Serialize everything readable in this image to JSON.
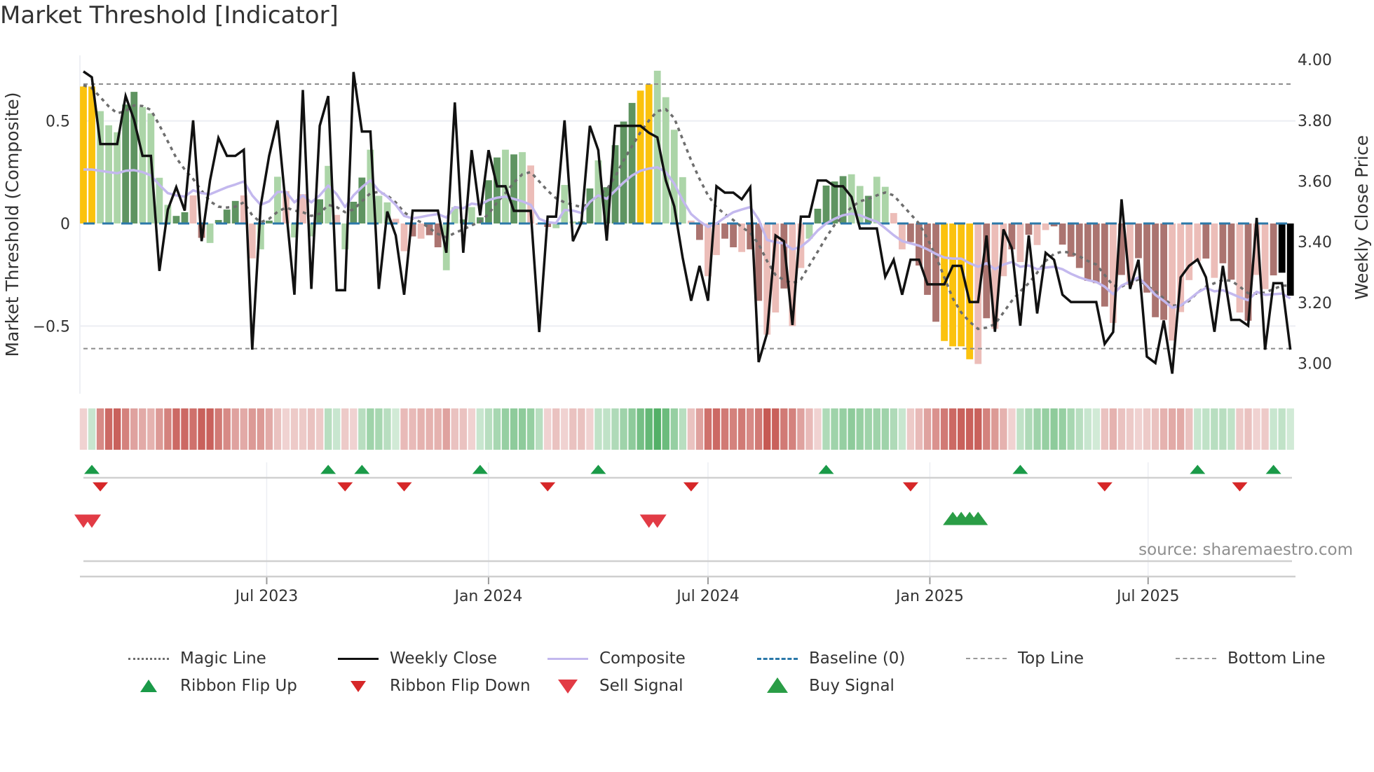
{
  "title": "Market Threshold [Indicator]",
  "source": "source: sharemaestro.com",
  "legend": [
    {
      "key": "magic",
      "label": "Magic Line"
    },
    {
      "key": "close",
      "label": "Weekly Close"
    },
    {
      "key": "composite",
      "label": "Composite"
    },
    {
      "key": "baseline",
      "label": "Baseline (0)"
    },
    {
      "key": "top",
      "label": "Top Line"
    },
    {
      "key": "bottom",
      "label": "Bottom Line"
    },
    {
      "key": "flip_up",
      "label": "Ribbon Flip Up"
    },
    {
      "key": "flip_down",
      "label": "Ribbon Flip Down"
    },
    {
      "key": "sell",
      "label": "Sell Signal"
    },
    {
      "key": "buy",
      "label": "Buy Signal"
    }
  ],
  "colors": {
    "extreme": "#fbc20d",
    "bull_strong": "#5f9461",
    "bull_weak": "#acd5a8",
    "bear_strong": "#ab7470",
    "bear_weak": "#ecbdb8",
    "magic": "#6e6e6e",
    "close": "#111111",
    "composite": "#c3b8ee",
    "baseline": "#2b78a9",
    "threshold": "#8c8c8c",
    "ribbon_green": "#4fae63",
    "ribbon_red": "#c5554f",
    "flip_up": "#1a9a48",
    "flip_down": "#d62728",
    "sell": "#e23b45",
    "buy": "#2a9d46"
  },
  "chart_data": {
    "type": "bar",
    "title": "Market Threshold [Indicator]",
    "ylabel": "Market Threshold (Composite)",
    "y2label": "Weekly Close Price",
    "ylim": [
      -0.83,
      0.82
    ],
    "y2lim": [
      2.9,
      4.014
    ],
    "yticks": [
      {
        "v": 0.5,
        "label": "0.5"
      },
      {
        "v": 0,
        "label": "0"
      },
      {
        "v": -0.5,
        "label": "−0.5"
      }
    ],
    "y2ticks": [
      {
        "v": 4.0,
        "label": "4.00"
      },
      {
        "v": 3.8,
        "label": "3.80"
      },
      {
        "v": 3.6,
        "label": "3.60"
      },
      {
        "v": 3.4,
        "label": "3.40"
      },
      {
        "v": 3.2,
        "label": "3.20"
      },
      {
        "v": 3.0,
        "label": "3.00"
      }
    ],
    "x_start": "2023-01-30",
    "x_step_days": 7,
    "xticks": [
      {
        "date": "2023-07-01",
        "label": "Jul 2023"
      },
      {
        "date": "2024-01-01",
        "label": "Jan 2024"
      },
      {
        "date": "2024-07-01",
        "label": "Jul 2024"
      },
      {
        "date": "2025-01-01",
        "label": "Jan 2025"
      },
      {
        "date": "2025-07-01",
        "label": "Jul 2025"
      }
    ],
    "top_line": 0.68,
    "bottom_line": -0.61,
    "baseline": 0,
    "bar_type_legend": {
      "Y": "extreme",
      "G": "bull_strong",
      "g": "bull_weak",
      "R": "bear_strong",
      "r": "bear_weak"
    },
    "composite_bars": [
      0.668,
      0.668,
      0.548,
      0.479,
      0.445,
      0.58,
      0.642,
      0.568,
      0.537,
      0.223,
      0.091,
      0.037,
      0.055,
      0.137,
      -0.07,
      -0.095,
      0.017,
      0.068,
      0.11,
      0.137,
      -0.17,
      -0.126,
      0.014,
      0.228,
      0.158,
      -0.068,
      0.143,
      -0.063,
      0.118,
      0.281,
      0.042,
      -0.126,
      0.106,
      0.224,
      0.36,
      0.135,
      0.103,
      0.023,
      -0.135,
      -0.063,
      -0.074,
      -0.057,
      -0.116,
      -0.228,
      0.08,
      0.02,
      0.08,
      0.03,
      0.211,
      0.322,
      0.36,
      0.337,
      0.348,
      0.283,
      -0.005,
      -0.017,
      -0.023,
      0.188,
      0.01,
      0.01,
      0.171,
      0.308,
      0.177,
      0.382,
      0.497,
      0.588,
      0.648,
      0.679,
      0.745,
      0.616,
      0.457,
      0.226,
      0.014,
      -0.08,
      -0.257,
      -0.154,
      -0.074,
      -0.116,
      -0.139,
      -0.126,
      -0.377,
      -0.542,
      -0.434,
      -0.317,
      -0.5,
      -0.217,
      -0.074,
      0.072,
      0.185,
      0.205,
      0.231,
      0.24,
      0.183,
      0.135,
      0.228,
      0.179,
      0.051,
      -0.126,
      -0.091,
      -0.205,
      -0.348,
      -0.479,
      -0.573,
      -0.599,
      -0.599,
      -0.662,
      -0.685,
      -0.462,
      -0.514,
      -0.257,
      -0.126,
      -0.188,
      -0.055,
      -0.105,
      -0.032,
      -0.014,
      -0.103,
      -0.162,
      -0.217,
      -0.28,
      -0.291,
      -0.405,
      -0.485,
      -0.251,
      -0.3,
      -0.169,
      -0.337,
      -0.457,
      -0.47,
      -0.571,
      -0.432,
      -0.276,
      -0.183,
      -0.171,
      -0.265,
      -0.194,
      -0.274,
      -0.434,
      -0.474,
      -0.251,
      -0.32,
      -0.253,
      -0.24,
      -0.352
    ],
    "bar_types": "YYgggGGggggGGrRgGGGrrgGgrgrgGgrgGGgggrrRrRRggGgGGGgGgrRRgggGGgGGGGYYggggrRrrRRrRRrrRrrgGGGGggGggrrRRRRYYYYrRrrRrRrrRRRRRRRrRrRRRRrrrrRrRRrRrrR",
    "weekly_close": [
      3.961,
      3.942,
      3.722,
      3.722,
      3.722,
      3.88,
      3.802,
      3.683,
      3.683,
      3.304,
      3.506,
      3.58,
      3.503,
      3.8,
      3.402,
      3.602,
      3.742,
      3.683,
      3.683,
      3.703,
      3.045,
      3.517,
      3.683,
      3.8,
      3.51,
      3.226,
      3.9,
      3.245,
      3.782,
      3.88,
      3.241,
      3.241,
      3.959,
      3.763,
      3.763,
      3.245,
      3.5,
      3.421,
      3.226,
      3.503,
      3.503,
      3.503,
      3.503,
      3.364,
      3.859,
      3.364,
      3.702,
      3.487,
      3.702,
      3.583,
      3.583,
      3.502,
      3.502,
      3.502,
      3.103,
      3.483,
      3.483,
      3.8,
      3.402,
      3.464,
      3.782,
      3.702,
      3.404,
      3.782,
      3.782,
      3.782,
      3.782,
      3.759,
      3.744,
      3.602,
      3.517,
      3.348,
      3.206,
      3.321,
      3.206,
      3.583,
      3.562,
      3.562,
      3.54,
      3.58,
      3.004,
      3.099,
      3.421,
      3.402,
      3.126,
      3.483,
      3.483,
      3.602,
      3.602,
      3.583,
      3.583,
      3.548,
      3.444,
      3.444,
      3.444,
      3.285,
      3.341,
      3.226,
      3.341,
      3.341,
      3.26,
      3.26,
      3.26,
      3.321,
      3.321,
      3.202,
      3.202,
      3.421,
      3.104,
      3.441,
      3.379,
      3.124,
      3.421,
      3.164,
      3.364,
      3.341,
      3.226,
      3.202,
      3.202,
      3.202,
      3.202,
      3.064,
      3.103,
      3.54,
      3.245,
      3.341,
      3.022,
      3.001,
      3.141,
      2.966,
      3.283,
      3.321,
      3.342,
      3.283,
      3.104,
      3.321,
      3.143,
      3.143,
      3.124,
      3.479,
      3.045,
      3.264,
      3.264,
      3.045
    ],
    "magic_line": [
      0.674,
      0.66,
      0.616,
      0.571,
      0.537,
      0.548,
      0.576,
      0.573,
      0.554,
      0.479,
      0.4,
      0.32,
      0.263,
      0.217,
      0.16,
      0.108,
      0.082,
      0.078,
      0.082,
      0.103,
      0.04,
      0.006,
      0.023,
      0.057,
      0.078,
      0.063,
      0.055,
      0.037,
      0.048,
      0.091,
      0.08,
      0.055,
      0.068,
      0.108,
      0.148,
      0.154,
      0.137,
      0.103,
      0.055,
      0.025,
      0.006,
      -0.023,
      -0.051,
      -0.068,
      -0.046,
      -0.029,
      -0.009,
      0.009,
      0.046,
      0.103,
      0.148,
      0.2,
      0.24,
      0.251,
      0.205,
      0.16,
      0.123,
      0.103,
      0.091,
      0.08,
      0.1,
      0.137,
      0.166,
      0.228,
      0.308,
      0.377,
      0.445,
      0.502,
      0.548,
      0.557,
      0.514,
      0.411,
      0.308,
      0.217,
      0.137,
      0.08,
      0.046,
      0.017,
      -0.017,
      -0.046,
      -0.1,
      -0.183,
      -0.251,
      -0.276,
      -0.291,
      -0.274,
      -0.205,
      -0.137,
      -0.068,
      -0.006,
      0.034,
      0.08,
      0.108,
      0.12,
      0.137,
      0.151,
      0.137,
      0.091,
      0.046,
      0,
      -0.074,
      -0.16,
      -0.263,
      -0.365,
      -0.434,
      -0.479,
      -0.514,
      -0.508,
      -0.491,
      -0.434,
      -0.377,
      -0.331,
      -0.291,
      -0.24,
      -0.183,
      -0.148,
      -0.137,
      -0.143,
      -0.16,
      -0.183,
      -0.2,
      -0.251,
      -0.303,
      -0.308,
      -0.285,
      -0.274,
      -0.303,
      -0.331,
      -0.365,
      -0.4,
      -0.4,
      -0.377,
      -0.337,
      -0.308,
      -0.291,
      -0.276,
      -0.279,
      -0.308,
      -0.34,
      -0.342,
      -0.337,
      -0.32,
      -0.303,
      -0.303
    ],
    "composite_line": [
      0.263,
      0.263,
      0.257,
      0.251,
      0.245,
      0.257,
      0.26,
      0.251,
      0.234,
      0.188,
      0.148,
      0.137,
      0.131,
      0.162,
      0.148,
      0.143,
      0.16,
      0.177,
      0.19,
      0.205,
      0.137,
      0.091,
      0.108,
      0.154,
      0.154,
      0.103,
      0.137,
      0.103,
      0.137,
      0.185,
      0.143,
      0.08,
      0.137,
      0.177,
      0.211,
      0.16,
      0.131,
      0.091,
      0.037,
      0.025,
      0.032,
      0.04,
      0.046,
      0.029,
      0.08,
      0.074,
      0.097,
      0.091,
      0.114,
      0.126,
      0.131,
      0.12,
      0.108,
      0.091,
      0.023,
      0.006,
      0.002,
      0.066,
      0.063,
      0.051,
      0.105,
      0.137,
      0.12,
      0.16,
      0.2,
      0.234,
      0.257,
      0.268,
      0.274,
      0.251,
      0.194,
      0.114,
      0.046,
      0.011,
      -0.017,
      0,
      0.029,
      0.055,
      0.068,
      0.08,
      0.02,
      -0.08,
      -0.091,
      -0.097,
      -0.126,
      -0.114,
      -0.08,
      -0.034,
      0,
      0.023,
      0.04,
      0.048,
      0.04,
      0.023,
      0.009,
      -0.023,
      -0.057,
      -0.086,
      -0.097,
      -0.108,
      -0.126,
      -0.148,
      -0.166,
      -0.171,
      -0.171,
      -0.194,
      -0.211,
      -0.194,
      -0.223,
      -0.2,
      -0.188,
      -0.211,
      -0.205,
      -0.223,
      -0.215,
      -0.211,
      -0.223,
      -0.245,
      -0.263,
      -0.276,
      -0.285,
      -0.308,
      -0.345,
      -0.303,
      -0.283,
      -0.263,
      -0.303,
      -0.348,
      -0.377,
      -0.411,
      -0.4,
      -0.371,
      -0.337,
      -0.314,
      -0.331,
      -0.325,
      -0.342,
      -0.36,
      -0.374,
      -0.333,
      -0.348,
      -0.345,
      -0.342,
      -0.365
    ],
    "ribbon": [
      -0.15,
      0.2,
      -0.6,
      -0.8,
      -0.85,
      -0.65,
      -0.45,
      -0.4,
      -0.35,
      -0.5,
      -0.65,
      -0.8,
      -0.8,
      -0.75,
      -0.85,
      -0.85,
      -0.7,
      -0.6,
      -0.45,
      -0.4,
      -0.5,
      -0.5,
      -0.4,
      -0.25,
      -0.15,
      -0.2,
      -0.2,
      -0.25,
      -0.2,
      0.3,
      0.2,
      -0.2,
      -0.15,
      0.3,
      0.45,
      0.4,
      0.3,
      0.15,
      -0.3,
      -0.3,
      -0.35,
      -0.35,
      -0.35,
      -0.45,
      -0.25,
      -0.25,
      -0.15,
      0.2,
      0.3,
      0.4,
      0.5,
      0.55,
      0.55,
      0.5,
      0.3,
      -0.15,
      -0.25,
      -0.15,
      -0.25,
      -0.25,
      -0.15,
      0.25,
      0.25,
      0.35,
      0.45,
      0.55,
      0.7,
      0.8,
      0.9,
      0.75,
      0.5,
      0.3,
      -0.25,
      -0.45,
      -0.75,
      -0.8,
      -0.7,
      -0.65,
      -0.7,
      -0.6,
      -0.7,
      -0.9,
      -0.85,
      -0.7,
      -0.65,
      -0.45,
      -0.3,
      -0.15,
      0.35,
      0.45,
      0.5,
      0.55,
      0.5,
      0.45,
      0.45,
      0.45,
      0.35,
      0.2,
      -0.2,
      -0.3,
      -0.45,
      -0.55,
      -0.7,
      -0.8,
      -0.85,
      -0.85,
      -0.85,
      -0.65,
      -0.5,
      -0.35,
      -0.15,
      0.25,
      0.35,
      0.45,
      0.5,
      0.55,
      0.5,
      0.4,
      0.3,
      0.2,
      0.15,
      -0.25,
      -0.35,
      -0.25,
      -0.2,
      -0.15,
      -0.2,
      -0.25,
      -0.35,
      -0.4,
      -0.4,
      -0.25,
      0.2,
      0.25,
      0.3,
      0.3,
      0.25,
      -0.2,
      -0.25,
      -0.15,
      -0.2,
      0.2,
      0.25,
      0.15
    ],
    "signals": {
      "flip_up_weeks": [
        2,
        30,
        34,
        48,
        62,
        89,
        112,
        133,
        142
      ],
      "flip_down_weeks": [
        3,
        32,
        39,
        56,
        73,
        99,
        122,
        138
      ],
      "sell_weeks": [
        1,
        2,
        68,
        69
      ],
      "buy_weeks": [
        104,
        105,
        106,
        107
      ]
    },
    "legend_placement": "bottom"
  }
}
